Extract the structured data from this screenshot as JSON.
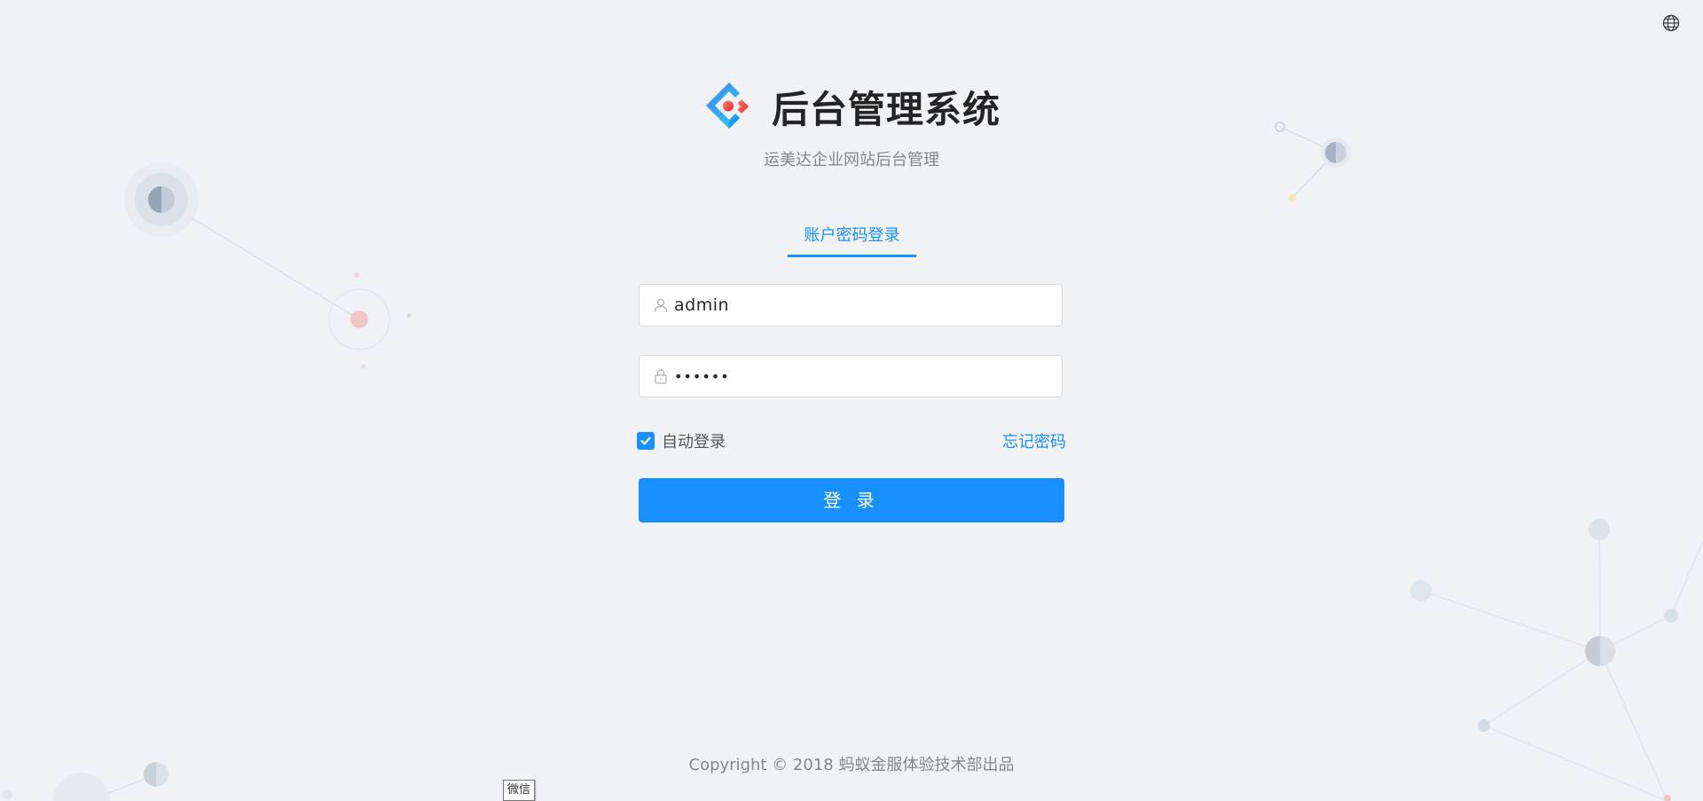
{
  "header": {
    "title": "后台管理系统",
    "subtitle": "运美达企业网站后台管理"
  },
  "tabs": [
    {
      "label": "账户密码登录",
      "active": true
    }
  ],
  "form": {
    "username": {
      "value": "admin",
      "icon": "user-icon"
    },
    "password": {
      "value": "••••••",
      "icon": "lock-icon"
    },
    "auto_login": {
      "label": "自动登录",
      "checked": true
    },
    "forgot_label": "忘记密码",
    "submit_label": "登 录"
  },
  "footer": {
    "copyright": "Copyright © 2018 蚂蚁金服体验技术部出品"
  },
  "tooltip": {
    "label": "微信"
  },
  "colors": {
    "primary": "#1890ff",
    "background": "#f0f2f5",
    "logo_red": "#f5222d"
  },
  "icons": {
    "lang": "globe-icon",
    "logo": "ant-design-logo",
    "check": "check-icon"
  }
}
